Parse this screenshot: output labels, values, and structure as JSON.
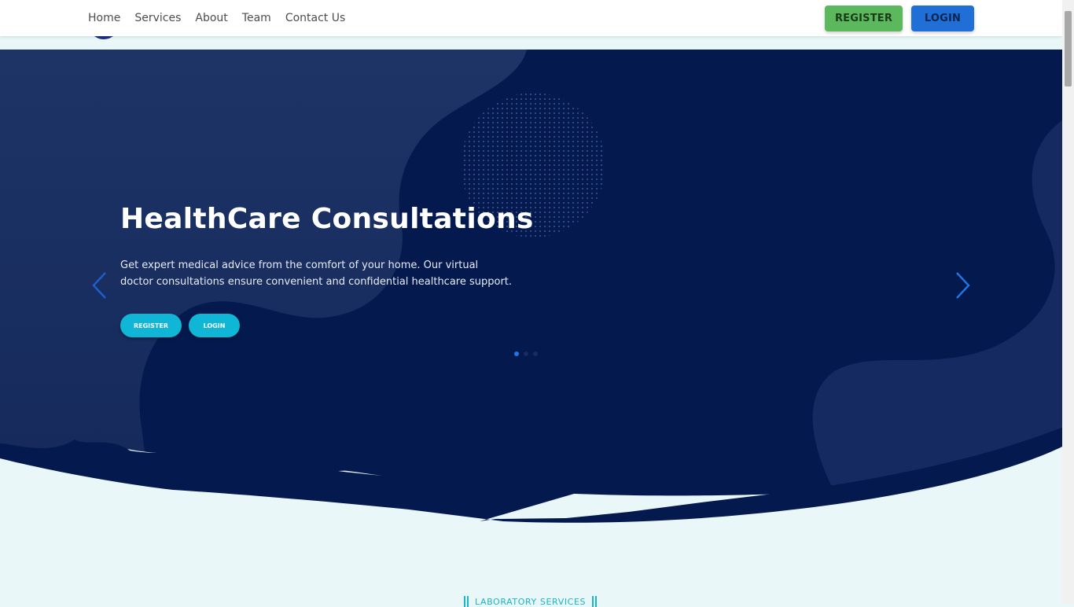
{
  "nav": {
    "links": [
      "Home",
      "Services",
      "About",
      "Team",
      "Contact Us"
    ],
    "register_label": "REGISTER",
    "login_label": "LOGIN"
  },
  "hero": {
    "title": "HealthCare Consultations",
    "description": "Get expert medical advice from the comfort of your home. Our virtual doctor consultations ensure convenient and confidential healthcare support.",
    "register_label": "REGISTER",
    "login_label": "LOGIN",
    "slides_count": 3,
    "active_slide": 1
  },
  "section": {
    "label": "LABORATORY SERVICES"
  },
  "colors": {
    "hero_bg": "#041a4e",
    "accent_cyan": "#10b6d6",
    "register_green": "#5cb85c",
    "login_blue": "#1f6fd6",
    "page_bg": "#e9f7f8"
  },
  "icons": [
    "chevron-left-icon",
    "chevron-right-icon"
  ]
}
